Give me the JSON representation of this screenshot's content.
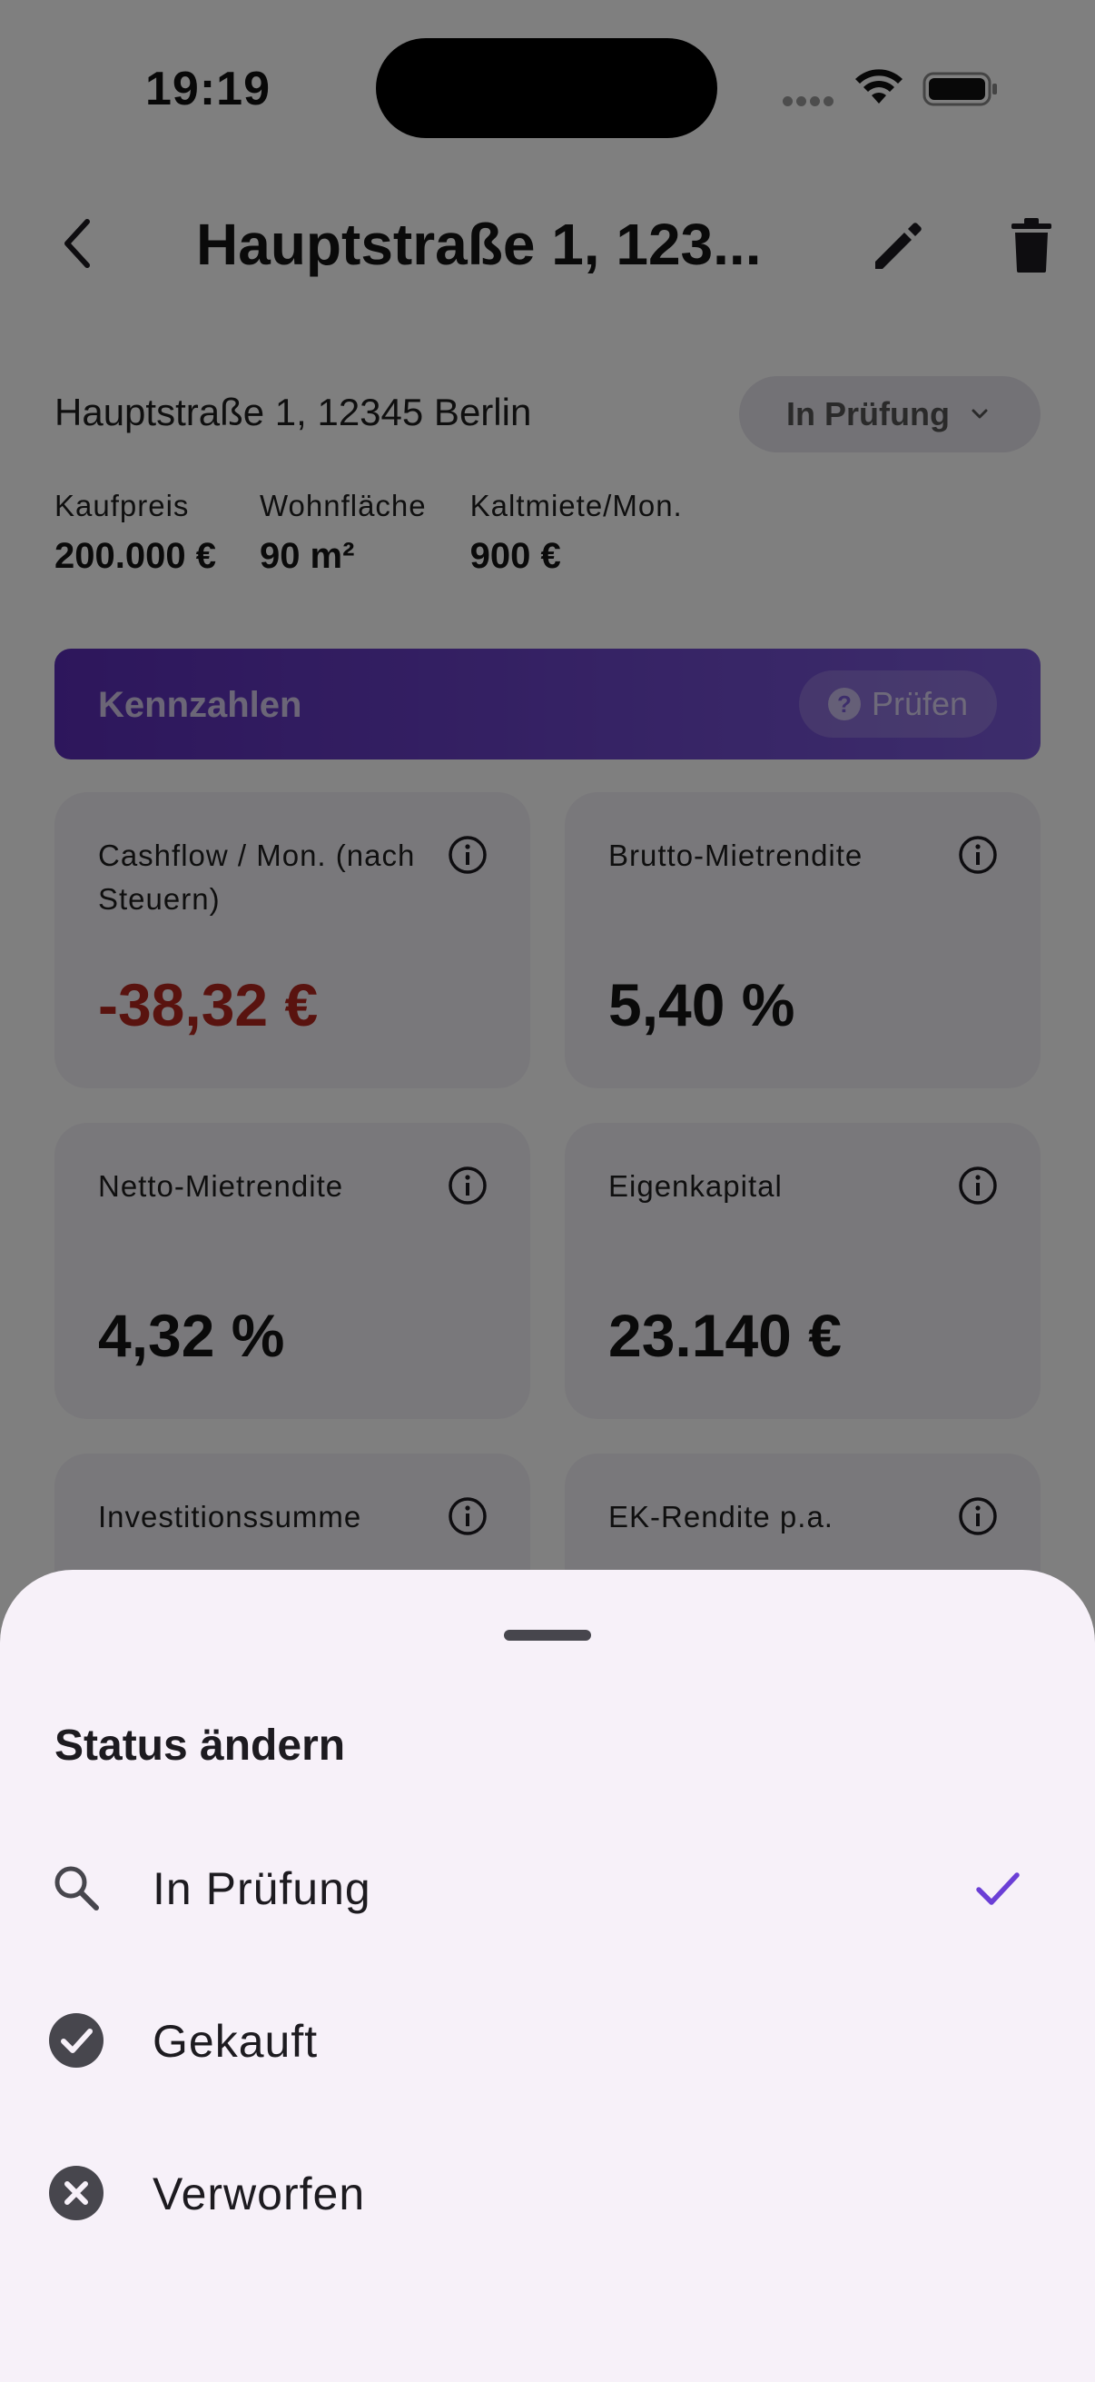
{
  "status_bar": {
    "time": "19:19"
  },
  "header": {
    "title": "Hauptstraße 1, 123..."
  },
  "property": {
    "address": "Hauptstraße 1, 12345 Berlin",
    "status_chip": "In Prüfung",
    "facts": [
      {
        "label": "Kaufpreis",
        "value": "200.000 €"
      },
      {
        "label": "Wohnfläche",
        "value": "90 m²"
      },
      {
        "label": "Kaltmiete/Mon.",
        "value": "900 €"
      }
    ]
  },
  "kennzahlen": {
    "title": "Kennzahlen",
    "check_label": "Prüfen",
    "cards": [
      {
        "label": "Cashflow / Mon. (nach Steuern)",
        "value": "-38,32 €"
      },
      {
        "label": "Brutto-Mietrendite",
        "value": "5,40 %"
      },
      {
        "label": "Netto-Mietrendite",
        "value": "4,32 %"
      },
      {
        "label": "Eigenkapital",
        "value": "23.140 €"
      },
      {
        "label": "Investitionssumme",
        "value": ""
      },
      {
        "label": "EK-Rendite p.a.",
        "value": ""
      }
    ]
  },
  "sheet": {
    "title": "Status ändern",
    "options": [
      {
        "label": "In Prüfung",
        "icon": "search-icon",
        "selected": true
      },
      {
        "label": "Gekauft",
        "icon": "check-circle-icon",
        "selected": false
      },
      {
        "label": "Verworfen",
        "icon": "cancel-circle-icon",
        "selected": false
      }
    ]
  },
  "colors": {
    "accent": "#6b3fd6",
    "negative": "#b3261e",
    "sheet_background": "#f7f1f9",
    "scrim": "rgba(0,0,0,0.5)"
  }
}
